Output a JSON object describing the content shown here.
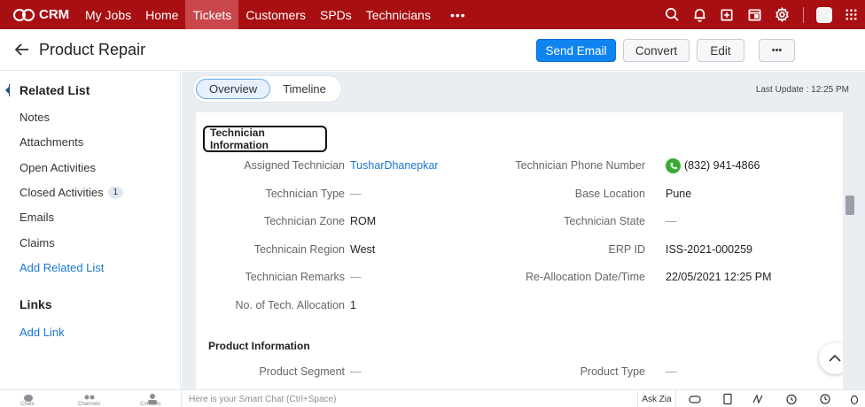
{
  "topnav": {
    "brand": "CRM",
    "items": [
      {
        "label": "My Jobs",
        "active": false
      },
      {
        "label": "Home",
        "active": false
      },
      {
        "label": "Tickets",
        "active": true
      },
      {
        "label": "Customers",
        "active": false
      },
      {
        "label": "SPDs",
        "active": false
      },
      {
        "label": "Technicians",
        "active": false
      }
    ],
    "more": "•••",
    "icons": [
      "search-icon",
      "bell-icon",
      "add-icon",
      "calendar-icon",
      "gear-icon"
    ]
  },
  "header": {
    "title": "Product Repair",
    "send_email": "Send Email",
    "convert": "Convert",
    "edit": "Edit",
    "more": "•••"
  },
  "sidebar": {
    "related_list_heading": "Related List",
    "items": [
      {
        "label": "Notes"
      },
      {
        "label": "Attachments"
      },
      {
        "label": "Open Activities"
      },
      {
        "label": "Closed Activities",
        "badge": "1"
      },
      {
        "label": "Emails"
      },
      {
        "label": "Claims"
      }
    ],
    "add_related_list": "Add Related List",
    "links_heading": "Links",
    "add_link": "Add Link"
  },
  "tabs": {
    "overview": "Overview",
    "timeline": "Timeline",
    "last_update": "Last Update : 12:25 PM"
  },
  "technician_info": {
    "title": "Technician Information",
    "left": [
      {
        "label": "Assigned Technician",
        "value": "TusharDhanepkar"
      },
      {
        "label": "Technician Type",
        "value": "—"
      },
      {
        "label": "Technician Zone",
        "value": "ROM"
      },
      {
        "label": "Technicain Region",
        "value": "West"
      },
      {
        "label": "Technician Remarks",
        "value": "—"
      },
      {
        "label": "No. of Tech. Allocation",
        "value": "1"
      }
    ],
    "right": [
      {
        "label": "Technician Phone Number",
        "value": "(832) 941-4866"
      },
      {
        "label": "Base Location",
        "value": "Pune"
      },
      {
        "label": "Technician State",
        "value": "—"
      },
      {
        "label": "ERP ID",
        "value": "ISS-2021-000259"
      },
      {
        "label": "Re-Allocation Date/Time",
        "value": "22/05/2021 12:25 PM"
      }
    ]
  },
  "product_info": {
    "title": "Product Information",
    "left": [
      {
        "label": "Product Segment",
        "value": "—"
      }
    ],
    "right": [
      {
        "label": "Product Type",
        "value": "—"
      }
    ]
  },
  "bottombar": {
    "labels": [
      "Chats",
      "Channels",
      "Contacts"
    ],
    "smart_chat": "Here is your Smart Chat (Ctrl+Space)",
    "ask_zia": "Ask Zia"
  },
  "colors": {
    "nav_bg": "#a80f12",
    "primary": "#0f84f0",
    "link": "#1b77d2"
  }
}
